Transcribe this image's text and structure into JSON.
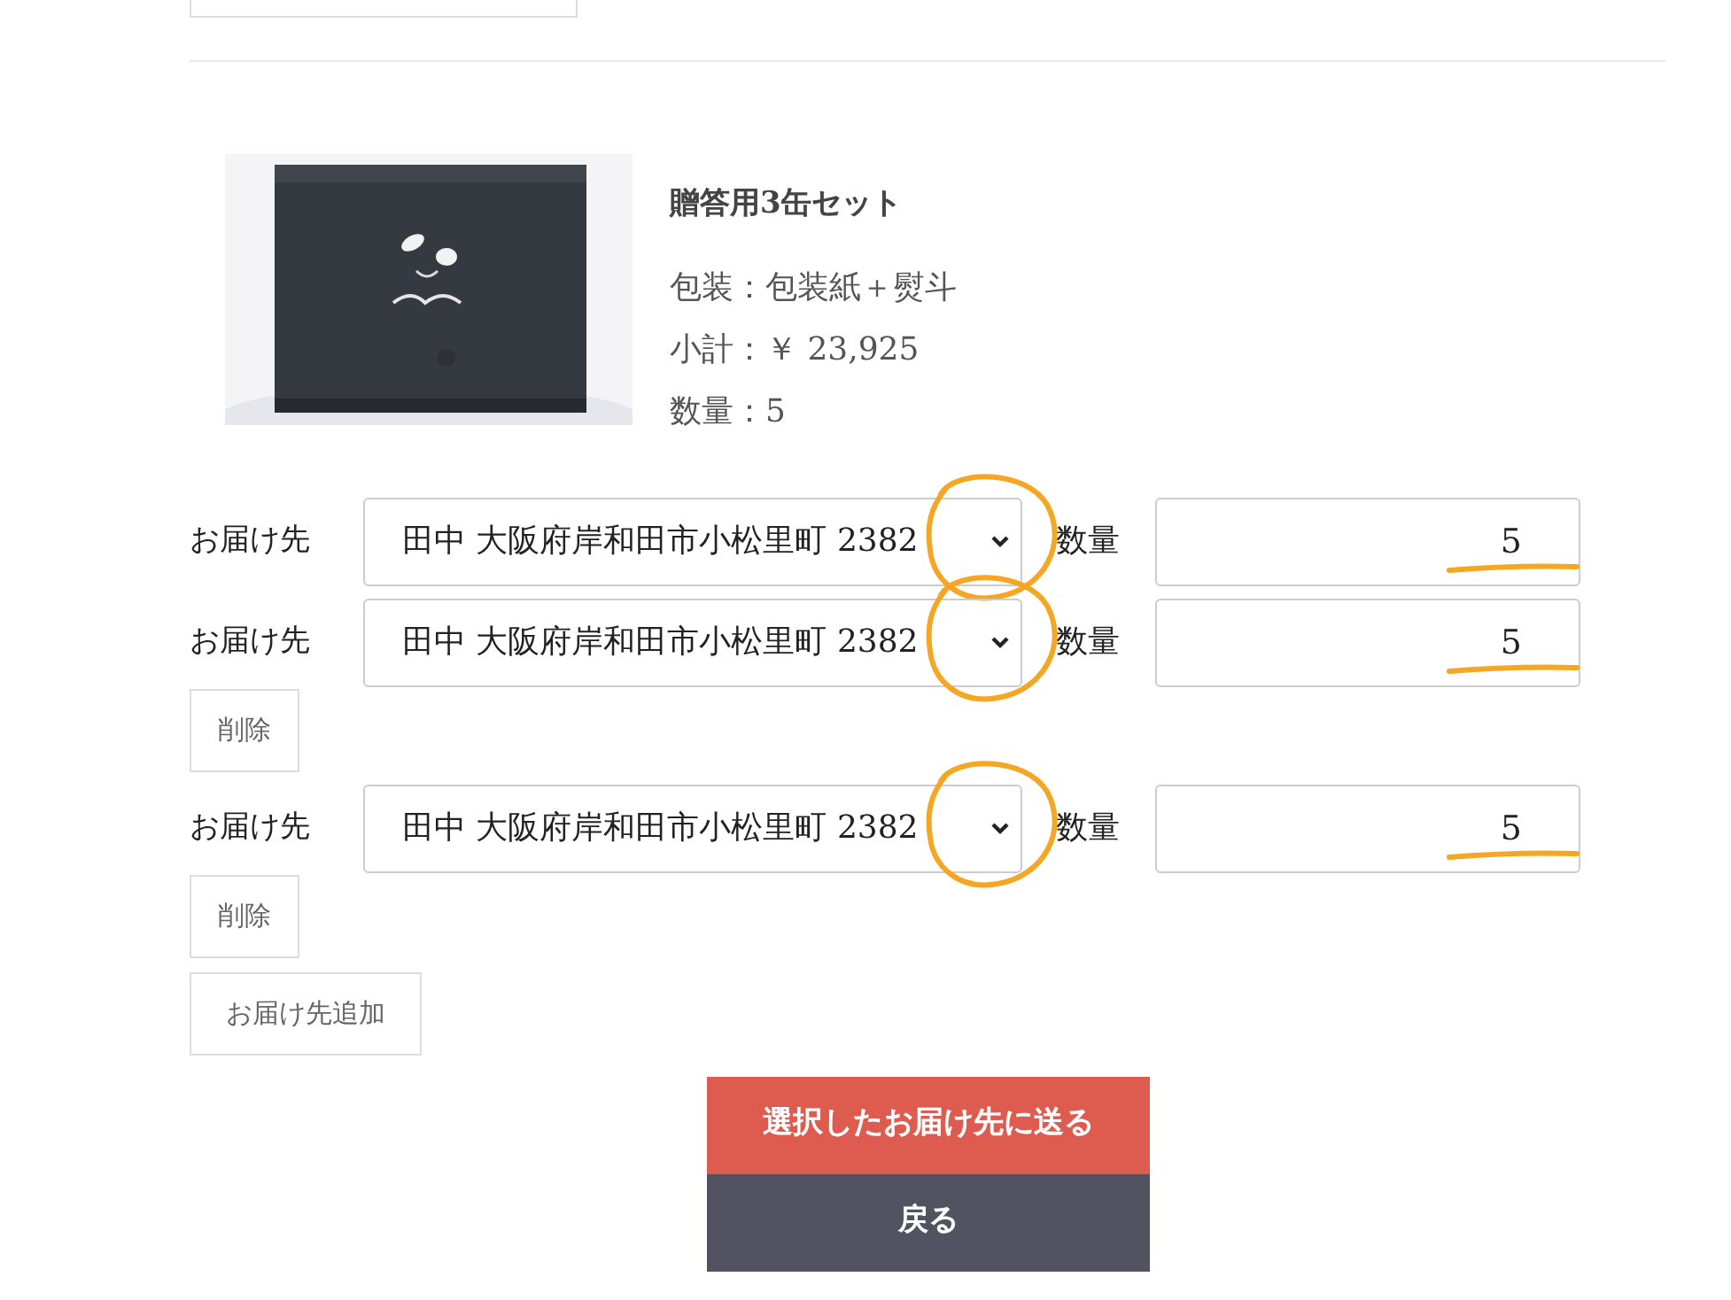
{
  "product": {
    "name": "贈答用3缶セット",
    "wrapping": "包装：包装紙＋熨斗",
    "subtotal": "小計：￥ 23,925",
    "quantity": "数量：5"
  },
  "deliveries": [
    {
      "label": "お届け先",
      "address": "田中 大阪府岸和田市小松里町 2382",
      "quantity_label": "数量",
      "quantity": "5"
    },
    {
      "label": "お届け先",
      "address": "田中 大阪府岸和田市小松里町 2382",
      "quantity_label": "数量",
      "quantity": "5",
      "delete_button": "削除"
    },
    {
      "label": "お届け先",
      "address": "田中 大阪府岸和田市小松里町 2382",
      "quantity_label": "数量",
      "quantity": "5",
      "delete_button": "削除"
    }
  ],
  "add_button": "お届け先追加",
  "submit_button": "選択したお届け先に送る",
  "back_button": "戻る"
}
